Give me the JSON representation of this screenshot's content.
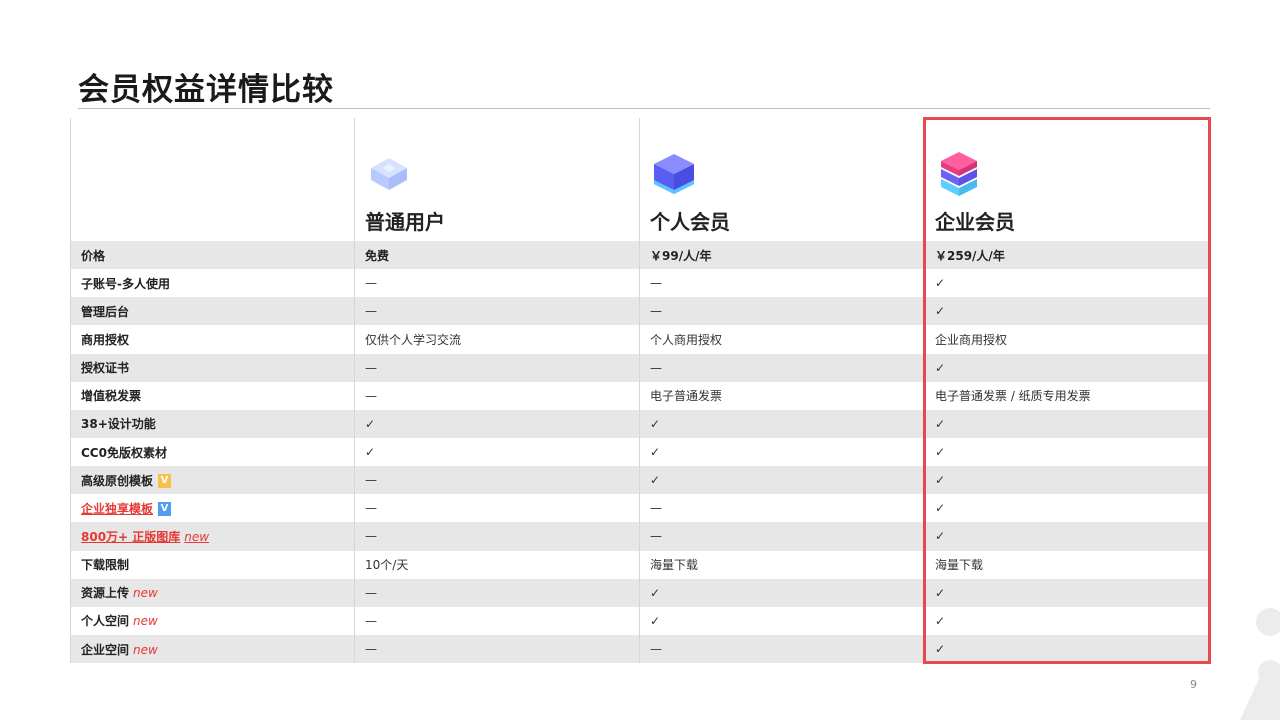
{
  "page": {
    "title": "会员权益详情比较",
    "page_number": "9"
  },
  "plans": [
    {
      "name": "普通用户",
      "icon": "light-blue-cube-icon"
    },
    {
      "name": "个人会员",
      "icon": "purple-cube-icon"
    },
    {
      "name": "企业会员",
      "icon": "pink-blue-stack-icon"
    }
  ],
  "colors": {
    "highlight": "#e8494f",
    "check": "#17a34a",
    "accent_red": "#e53935",
    "row_shade": "#e7e7e7"
  },
  "rows": [
    {
      "feature": "价格",
      "cells": [
        "免费",
        "￥99/人/年",
        "￥259/人/年"
      ]
    },
    {
      "feature": "子账号-多人使用",
      "cells": [
        "—",
        "—",
        "✓"
      ]
    },
    {
      "feature": "管理后台",
      "cells": [
        "—",
        "—",
        "✓"
      ]
    },
    {
      "feature": "商用授权",
      "cells": [
        "仅供个人学习交流",
        "个人商用授权",
        "企业商用授权"
      ]
    },
    {
      "feature": "授权证书",
      "cells": [
        "—",
        "—",
        "✓"
      ]
    },
    {
      "feature": "增值税发票",
      "cells": [
        "—",
        "电子普通发票",
        "电子普通发票 / 纸质专用发票"
      ]
    },
    {
      "feature": "38+设计功能",
      "cells": [
        "✓",
        "✓",
        "✓"
      ]
    },
    {
      "feature": "CC0免版权素材",
      "cells": [
        "✓",
        "✓",
        "✓"
      ]
    },
    {
      "feature": "高级原创模板",
      "badge": "V",
      "cells": [
        "—",
        "✓",
        "✓"
      ]
    },
    {
      "feature": "企业独享模板",
      "badge": "V",
      "cells": [
        "—",
        "—",
        "✓"
      ]
    },
    {
      "feature": "800万+ 正版图库",
      "tag": "new",
      "cells": [
        "—",
        "—",
        "✓"
      ]
    },
    {
      "feature": "下载限制",
      "cells": [
        "10个/天",
        "海量下载",
        "海量下载"
      ]
    },
    {
      "feature": "资源上传",
      "tag": "new",
      "cells": [
        "—",
        "✓",
        "✓"
      ]
    },
    {
      "feature": "个人空间",
      "tag": "new",
      "cells": [
        "—",
        "✓",
        "✓"
      ]
    },
    {
      "feature": "企业空间",
      "tag": "new",
      "cells": [
        "—",
        "—",
        "✓"
      ]
    }
  ]
}
